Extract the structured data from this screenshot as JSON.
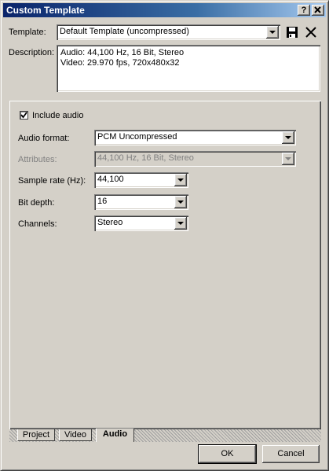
{
  "window": {
    "title": "Custom Template"
  },
  "titlebar_buttons": {
    "help": "?",
    "close": "X"
  },
  "template": {
    "label": "Template:",
    "value": "Default Template (uncompressed)"
  },
  "description": {
    "label": "Description:",
    "line1": "Audio: 44,100 Hz, 16 Bit, Stereo",
    "line2": "Video: 29.970 fps, 720x480x32"
  },
  "audio": {
    "include_label": "Include audio",
    "include_checked": true,
    "format_label": "Audio format:",
    "format_value": "PCM Uncompressed",
    "attributes_label": "Attributes:",
    "attributes_value": "44,100 Hz, 16 Bit, Stereo",
    "sample_rate_label": "Sample rate (Hz):",
    "sample_rate_value": "44,100",
    "bit_depth_label": "Bit depth:",
    "bit_depth_value": "16",
    "channels_label": "Channels:",
    "channels_value": "Stereo"
  },
  "tabs": [
    {
      "label": "Project",
      "active": false
    },
    {
      "label": "Video",
      "active": false
    },
    {
      "label": "Audio",
      "active": true
    }
  ],
  "buttons": {
    "ok": "OK",
    "cancel": "Cancel"
  },
  "icons": {
    "save": "save-icon",
    "delete": "delete-icon"
  }
}
